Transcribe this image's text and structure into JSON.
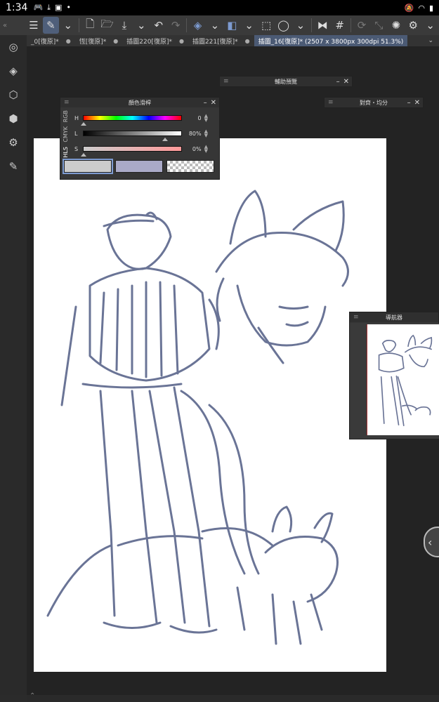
{
  "status_bar": {
    "time": "1:34",
    "left_icons": [
      "gamepad-icon",
      "download-icon",
      "image-icon",
      "dot-icon"
    ],
    "right_icons": [
      "mute-icon",
      "wifi-icon",
      "battery-icon"
    ]
  },
  "toolbar": {
    "buttons": [
      "menu-icon",
      "pen-icon",
      "new-file-icon",
      "open-folder-icon",
      "save-icon",
      "undo-icon",
      "redo-icon",
      "layer-mask-icon",
      "fill-icon",
      "selection-icon",
      "lasso-icon",
      "flip-icon",
      "grid-icon",
      "sync-icon",
      "transform-icon",
      "loading-icon",
      "settings-icon"
    ]
  },
  "tabs": [
    {
      "label": "_0[復原]*",
      "active": false
    },
    {
      "label": "恆[復原]*",
      "active": false
    },
    {
      "label": "插圖220[復原]*",
      "active": false
    },
    {
      "label": "插圖221[復原]*",
      "active": false
    },
    {
      "label": "插圖_16[復原]* (2507 x 3800px 300dpi 51.3%)",
      "active": true
    }
  ],
  "left_sidebar": {
    "icons": [
      "brush-icon",
      "layers-icon",
      "material-icon",
      "3d-object-icon",
      "3d-settings-icon",
      "edit-icon"
    ]
  },
  "panels": {
    "preview": {
      "title": "輔助預覽"
    },
    "align": {
      "title": "對齊・均分"
    },
    "color_slider": {
      "title": "顏色滑桿",
      "tabs": [
        "RGB",
        "CMYK",
        "HLS"
      ],
      "active_tab": "HLS",
      "sliders": [
        {
          "label": "H",
          "value": "0",
          "fraction": 0.0
        },
        {
          "label": "L",
          "value": "80%",
          "fraction": 0.8
        },
        {
          "label": "S",
          "value": "0%",
          "fraction": 0.0
        }
      ],
      "swatches": {
        "main": "#cccccc",
        "sub": "#aaaac8"
      }
    },
    "navigator": {
      "title": "導航器"
    }
  },
  "colors": {
    "sketch_line": "#6a7496",
    "accent": "#4b5a74"
  }
}
